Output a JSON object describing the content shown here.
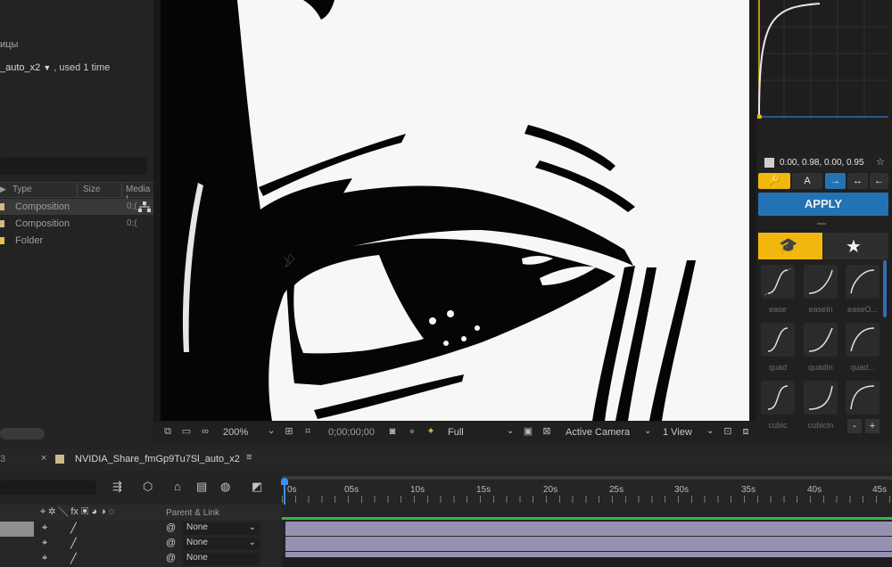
{
  "project": {
    "header_partial": "ицы",
    "footage_name": "_auto_x2",
    "used_text": ", used 1 time",
    "columns": [
      "Type",
      "Size",
      "Media I"
    ],
    "rows": [
      {
        "type": "Composition",
        "size": "0;(",
        "color": "#cdbb8a",
        "selected": true
      },
      {
        "type": "Composition",
        "size": "0;(",
        "color": "#cdbb8a",
        "selected": false
      },
      {
        "type": "Folder",
        "size": "",
        "color": "#e8c341",
        "selected": false
      }
    ]
  },
  "viewer": {
    "zoom": "200%",
    "timecode": "0;00;00;00",
    "resolution": "Full",
    "camera": "Active Camera",
    "views": "1 View"
  },
  "flow": {
    "bezier_values": "0.00, 0.98, 0.00, 0.95",
    "apply_label": "APPLY",
    "presets": [
      {
        "label": "ease"
      },
      {
        "label": "easeIn"
      },
      {
        "label": "easeO..."
      },
      {
        "label": "quad"
      },
      {
        "label": "quadIn"
      },
      {
        "label": "quad..."
      },
      {
        "label": "cubic"
      },
      {
        "label": "cubicIn"
      },
      {
        "label": ""
      }
    ],
    "colors": {
      "accent_yellow": "#f1b70d",
      "apply_blue": "#2372b6"
    }
  },
  "timeline": {
    "panel_number": "3",
    "comp_tab": "NVIDIA_Share_fmGp9Tu7Sl_auto_x2",
    "time_start": "0s",
    "time_marks": [
      "05s",
      "10s",
      "15s",
      "20s",
      "25s",
      "30s",
      "35s",
      "40s",
      "45s"
    ],
    "parent_header": "Parent & Link",
    "parent_values": [
      "None",
      "None",
      "None"
    ]
  }
}
